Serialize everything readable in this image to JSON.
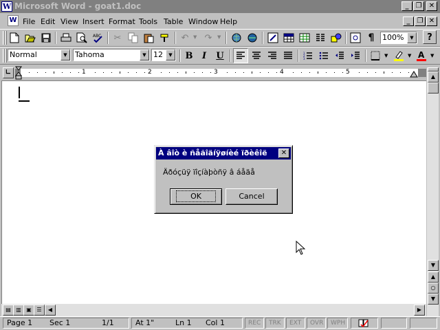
{
  "window": {
    "app_title": "Microsoft Word - goat1.doc"
  },
  "menu": [
    "File",
    "Edit",
    "View",
    "Insert",
    "Format",
    "Tools",
    "Table",
    "Window",
    "Help"
  ],
  "formatting": {
    "style": "Normal",
    "font": "Tahoma",
    "size": "12"
  },
  "standard_toolbar": {
    "zoom": "100%"
  },
  "ruler": {
    "numbers": [
      "1",
      "2",
      "3",
      "4",
      "5"
    ]
  },
  "dialog": {
    "title": "À âîò è ñåãîäíÿøíèé ïðèêîë",
    "message": "Äðóçüÿ ïîçíàþòñÿ â áåäå",
    "ok_label": "OK",
    "cancel_label": "Cancel"
  },
  "status": {
    "page": "Page 1",
    "sec": "Sec 1",
    "page_count": "1/1",
    "at": "At 1\"",
    "line": "Ln 1",
    "col": "Col 1",
    "rec": "REC",
    "trk": "TRK",
    "ext": "EXT",
    "ovr": "OVR",
    "wph": "WPH"
  },
  "colors": {
    "titlebar_inactive": "#808080",
    "dialog_title": "#000080",
    "highlight": "#ffff00",
    "font_color": "#ff0000"
  }
}
